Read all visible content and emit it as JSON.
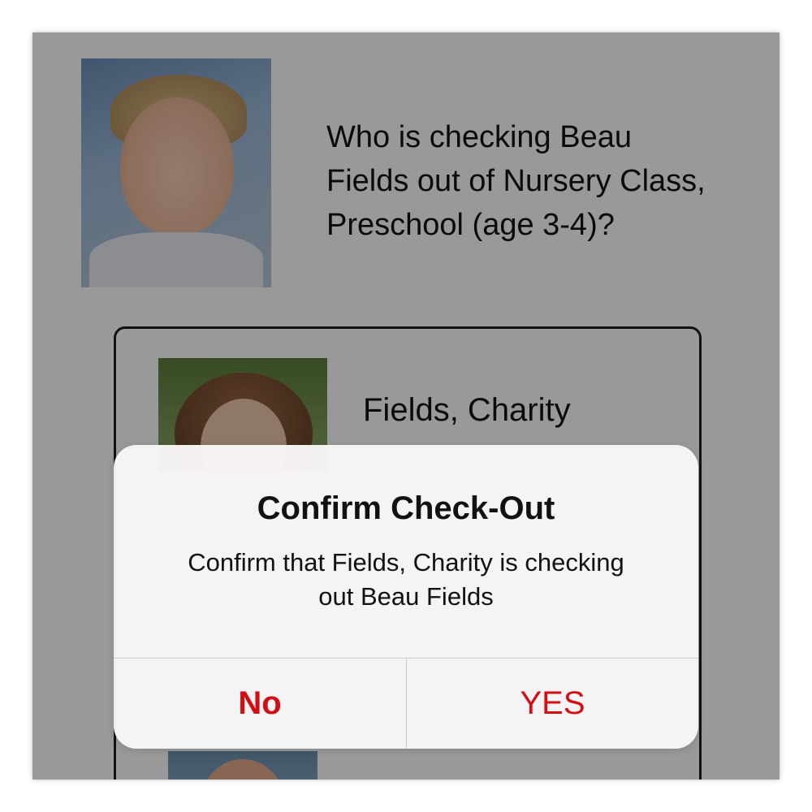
{
  "header": {
    "question": "Who is checking Beau Fields out of Nursery Class, Preschool (age 3-4)?"
  },
  "list": {
    "items": [
      {
        "name": "Fields, Charity"
      }
    ]
  },
  "alert": {
    "title": "Confirm Check-Out",
    "message": "Confirm that Fields, Charity is checking out Beau Fields",
    "no_label": "No",
    "yes_label": "YES"
  },
  "colors": {
    "button_red": "#d10f13",
    "dim_overlay": "rgba(0,0,0,0.40)",
    "alert_background": "#f8f6f6"
  },
  "icons": {
    "child_photo": "child-photo",
    "parent_photo": "parent-photo"
  }
}
